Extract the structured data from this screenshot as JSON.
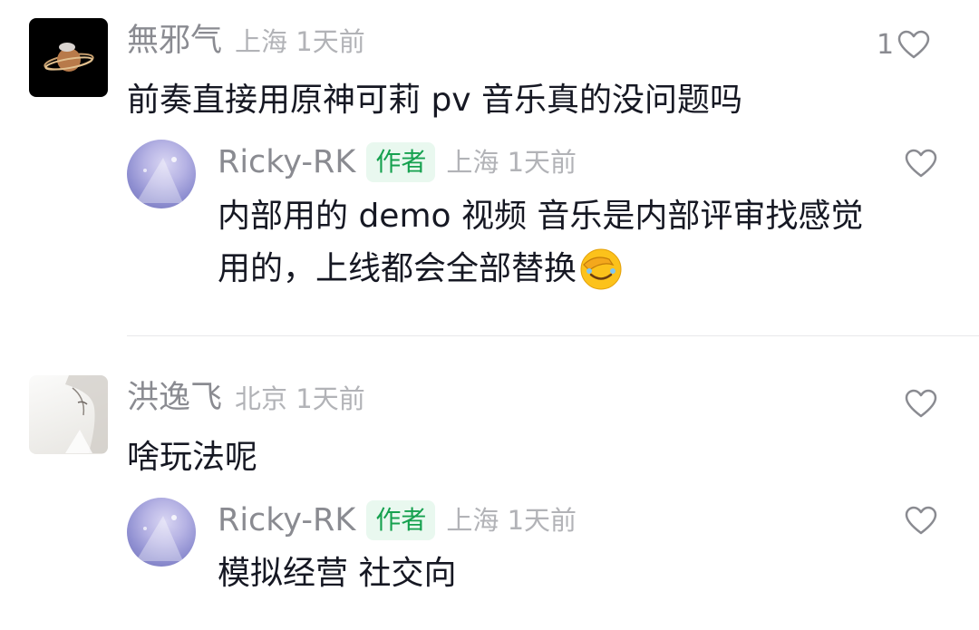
{
  "comments": [
    {
      "author": "無邪气",
      "location": "上海",
      "time": "1天前",
      "text": "前奏直接用原神可莉 pv 音乐真的没问题吗",
      "like_count": "1",
      "reply": {
        "author": "Ricky-RK",
        "badge": "作者",
        "location": "上海",
        "time": "1天前",
        "text_line1": "内部用的 demo 视频  音乐是内部评审找感觉",
        "text_line2": "用的，上线都会全部替换",
        "emoji": "🤦"
      }
    },
    {
      "author": "洪逸飞",
      "location": "北京",
      "time": "1天前",
      "text": "啥玩法呢",
      "reply": {
        "author": "Ricky-RK",
        "badge": "作者",
        "location": "上海",
        "time": "1天前",
        "text": "模拟经营  社交向"
      }
    }
  ],
  "icons": {
    "like": "heart-outline-icon",
    "emoji": "facepalm-emoji"
  },
  "colors": {
    "author_badge_bg": "#e9f8ef",
    "author_badge_text": "#16a14f",
    "name": "#8a8b91",
    "meta": "#b2b3b7",
    "text": "#161823"
  }
}
